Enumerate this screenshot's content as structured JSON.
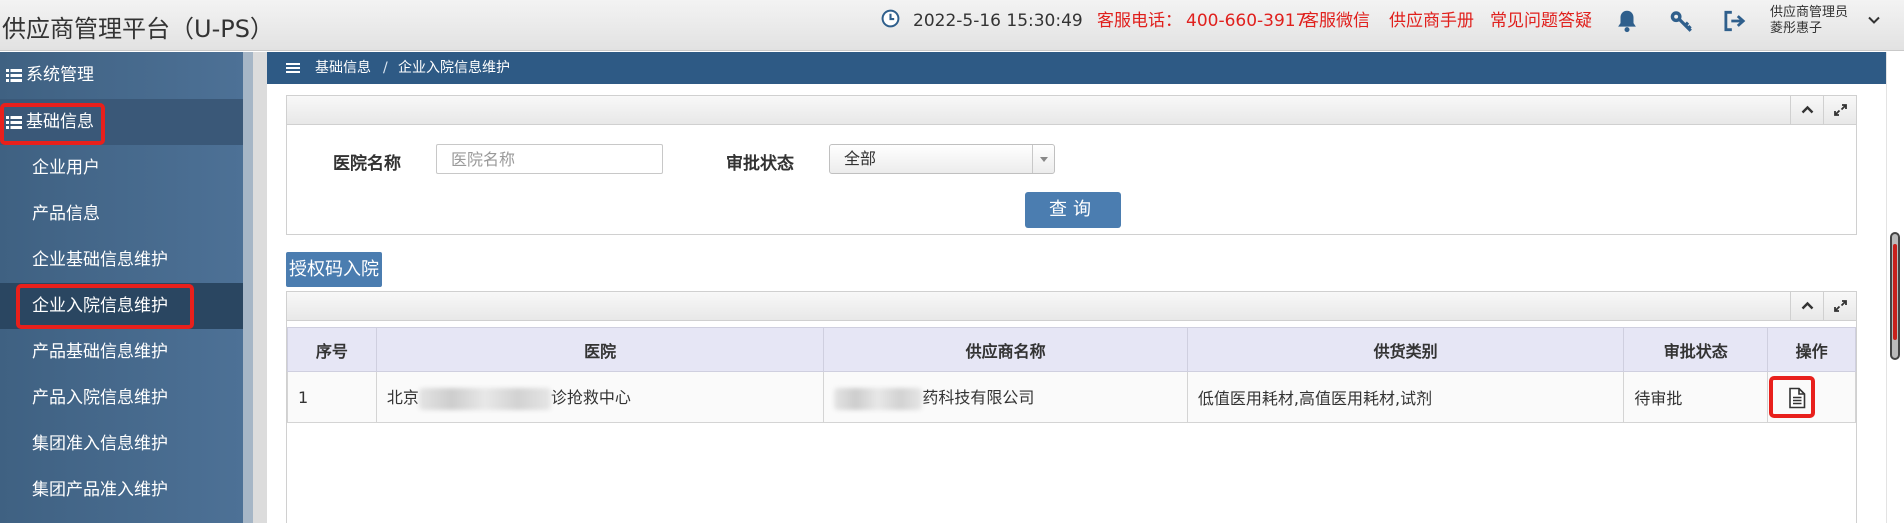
{
  "header": {
    "app_title": "供应商管理平台（U-PS）",
    "datetime": "2022-5-16  15:30:49",
    "service_phone_label": "客服电话：",
    "service_phone": "400-660-3917",
    "links": {
      "wechat": "客服微信",
      "manual": "供应商手册",
      "faq": "常见问题答疑"
    },
    "user": {
      "role": "供应商管理员",
      "name": "菱彤惠子"
    }
  },
  "sidebar": {
    "groups": [
      {
        "label": "系统管理"
      },
      {
        "label": "基础信息"
      }
    ],
    "items": [
      {
        "label": "企业用户"
      },
      {
        "label": "产品信息"
      },
      {
        "label": "企业基础信息维护"
      },
      {
        "label": "企业入院信息维护"
      },
      {
        "label": "产品基础信息维护"
      },
      {
        "label": "产品入院信息维护"
      },
      {
        "label": "集团准入信息维护"
      },
      {
        "label": "集团产品准入维护"
      }
    ]
  },
  "breadcrumb": {
    "parent": "基础信息",
    "separator": "/",
    "current": "企业入院信息维护"
  },
  "filters": {
    "hospital_label": "医院名称",
    "hospital_placeholder": "医院名称",
    "status_label": "审批状态",
    "status_value": "全部",
    "query_button": "查询"
  },
  "auth_button": "授权码入院",
  "table": {
    "columns": [
      "序号",
      "医院",
      "供应商名称",
      "供货类别",
      "审批状态",
      "操作"
    ],
    "rows": [
      {
        "index": "1",
        "hospital_prefix": "北京",
        "hospital_suffix": "诊抢救中心",
        "supplier_suffix": "药科技有限公司",
        "category": "低值医用耗材,高值医用耗材,试剂",
        "status": "待审批"
      }
    ]
  },
  "colors": {
    "sidebar": "#4a6d92",
    "breadcrumb": "#2e5a85",
    "button": "#4b7db0",
    "header_link": "#e0201d",
    "table_header": "#e6e6f5"
  },
  "icons": [
    "clock-icon",
    "bell-icon",
    "key-icon",
    "logout-icon",
    "chevron-down-icon",
    "list-icon",
    "menu-icon",
    "collapse-icon",
    "expand-icon",
    "document-icon"
  ]
}
